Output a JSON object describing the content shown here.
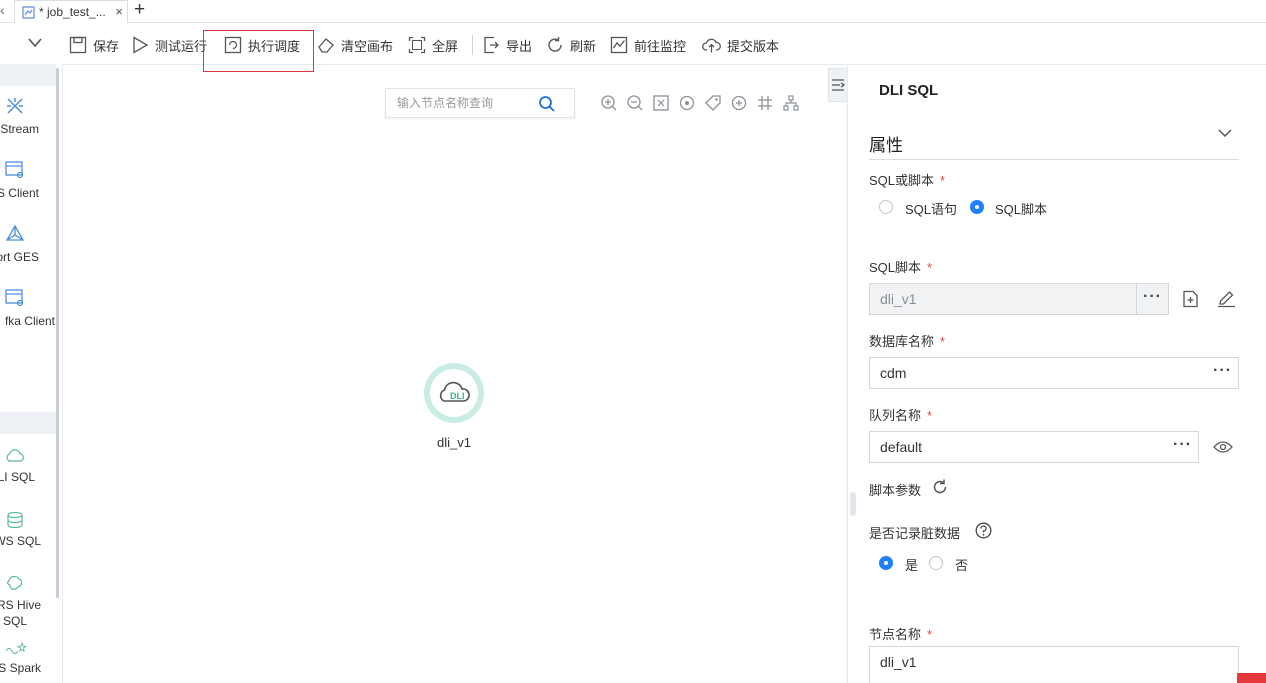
{
  "tab": {
    "title": "* job_test_...",
    "close": "×",
    "add": "+",
    "back": "‹"
  },
  "toolbar": {
    "save": "保存",
    "test_run": "测试运行",
    "schedule": "执行调度",
    "clear_canvas": "清空画布",
    "fullscreen": "全屏",
    "export": "导出",
    "refresh": "刷新",
    "monitor": "前往监控",
    "submit_version": "提交版本"
  },
  "left_nodes": [
    {
      "label": "S Stream",
      "icon": "cs-stream-icon"
    },
    {
      "label": "S Client",
      "icon": "cs-client-icon"
    },
    {
      "label": "port GES",
      "icon": "import-ges-icon"
    },
    {
      "label": "fka Client",
      "icon": "kafka-client-icon"
    },
    {
      "label": "DLI SQL",
      "icon": "dli-sql-icon"
    },
    {
      "label": "WS SQL",
      "icon": "dws-sql-icon"
    },
    {
      "label": "RS Hive",
      "label2": "SQL",
      "icon": "mrs-hive-icon"
    },
    {
      "label": "RS Spark",
      "icon": "mrs-spark-icon"
    }
  ],
  "canvas": {
    "search_placeholder": "输入节点名称查询",
    "node": {
      "label": "dli_v1",
      "badge": "DLI"
    }
  },
  "panel": {
    "title": "DLI SQL",
    "section": "属性",
    "sql_or_script_label": "SQL或脚本",
    "opt_sql": "SQL语句",
    "opt_script": "SQL脚本",
    "script_label": "SQL脚本",
    "script_value": "dli_v1",
    "db_label": "数据库名称",
    "db_value": "cdm",
    "queue_label": "队列名称",
    "queue_value": "default",
    "params_label": "脚本参数",
    "dirty_label": "是否记录脏数据",
    "yes": "是",
    "no": "否",
    "node_name_label": "节点名称",
    "node_name_value": "dli_v1",
    "required": "*",
    "dots": "···"
  }
}
